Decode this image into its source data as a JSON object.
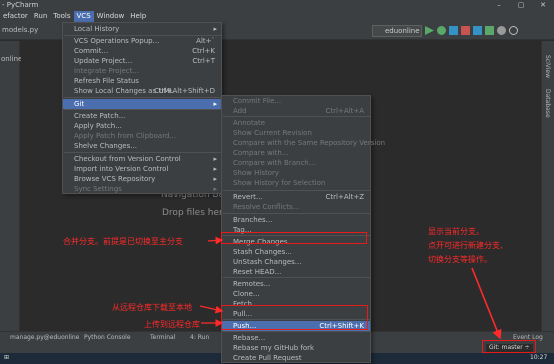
{
  "window": {
    "title": "- PyCharm",
    "controls": [
      "–",
      "▢",
      "✕"
    ]
  },
  "menubar": [
    {
      "label": "efactor"
    },
    {
      "label": "Run"
    },
    {
      "label": "Tools"
    },
    {
      "label": "VCS",
      "active": true
    },
    {
      "label": "Window"
    },
    {
      "label": "Help"
    }
  ],
  "toolbar": {
    "file_tab": "models.py",
    "run_config": "eduonline"
  },
  "left_panel": {
    "label": "online"
  },
  "right_panel": {
    "labels": [
      "SciView",
      "Database"
    ]
  },
  "editor": {
    "hint_nav": "Navigation Bar",
    "hint_drop": "Drop files here to"
  },
  "vcs_menu": {
    "items": [
      {
        "label": "Local History",
        "arrow": true
      },
      {
        "label": "VCS Operations Popup...",
        "shortcut": "Alt+`"
      },
      {
        "label": "Commit...",
        "shortcut": "Ctrl+K"
      },
      {
        "label": "Update Project...",
        "shortcut": "Ctrl+T"
      },
      {
        "label": "Integrate Project...",
        "disabled": true
      },
      {
        "label": "Refresh File Status"
      },
      {
        "label": "Show Local Changes as UML",
        "shortcut": "Ctrl+Alt+Shift+D"
      },
      {
        "label": "Git",
        "arrow": true,
        "highlight": true
      },
      {
        "label": "Create Patch..."
      },
      {
        "label": "Apply Patch..."
      },
      {
        "label": "Apply Patch from Clipboard...",
        "disabled": true
      },
      {
        "label": "Shelve Changes..."
      },
      {
        "label": "Checkout from Version Control",
        "arrow": true
      },
      {
        "label": "Import into Version Control",
        "arrow": true
      },
      {
        "label": "Browse VCS Repository",
        "arrow": true
      },
      {
        "label": "Sync Settings",
        "arrow": true,
        "disabled": true
      }
    ]
  },
  "git_menu": {
    "items": [
      {
        "label": "Commit File...",
        "disabled": true
      },
      {
        "label": "Add",
        "shortcut": "Ctrl+Alt+A",
        "disabled": true
      },
      {
        "label": "Annotate",
        "disabled": true
      },
      {
        "label": "Show Current Revision",
        "disabled": true
      },
      {
        "label": "Compare with the Same Repository Version",
        "disabled": true
      },
      {
        "label": "Compare with...",
        "disabled": true
      },
      {
        "label": "Compare with Branch...",
        "disabled": true
      },
      {
        "label": "Show History",
        "disabled": true
      },
      {
        "label": "Show History for Selection",
        "disabled": true
      },
      {
        "label": "Revert...",
        "shortcut": "Ctrl+Alt+Z"
      },
      {
        "label": "Resolve Conflicts...",
        "disabled": true
      },
      {
        "label": "Branches..."
      },
      {
        "label": "Tag..."
      },
      {
        "label": "Merge Changes..."
      },
      {
        "label": "Stash Changes..."
      },
      {
        "label": "UnStash Changes..."
      },
      {
        "label": "Reset HEAD..."
      },
      {
        "label": "Remotes..."
      },
      {
        "label": "Clone..."
      },
      {
        "label": "Fetch"
      },
      {
        "label": "Pull..."
      },
      {
        "label": "Push...",
        "shortcut": "Ctrl+Shift+K",
        "highlight": true
      },
      {
        "label": "Rebase..."
      },
      {
        "label": "Rebase my GitHub fork"
      },
      {
        "label": "Create Pull Request"
      }
    ]
  },
  "annotations": {
    "merge": "合并分支。前提是已切换至主分支",
    "branch_line1": "显示当前分支。",
    "branch_line2": "点开可进行新建分支、",
    "branch_line3": "切换分支等操作。",
    "pull": "从远程仓库下载至本地",
    "push": "上传到远程仓库"
  },
  "status": {
    "tool_windows": [
      "manage.py@eduonline",
      "Python Console",
      "Terminal",
      "4: Run"
    ],
    "event_log": "Event Log",
    "git_branch": "Git: master ÷"
  },
  "taskbar": {
    "clock": "10:27"
  },
  "colors": {
    "accent": "#4b6eaf",
    "annotation": "#ff2a2a"
  }
}
